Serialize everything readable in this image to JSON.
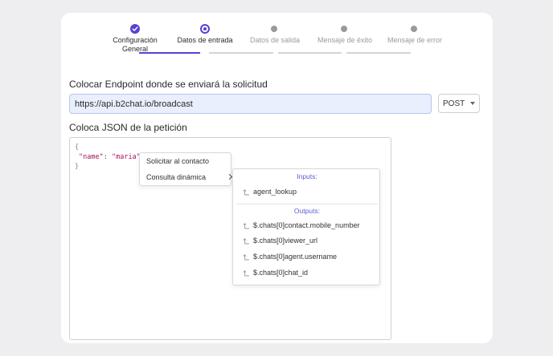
{
  "stepper": {
    "steps": [
      {
        "label_line1": "Configuración",
        "label_line2": "General",
        "state": "done"
      },
      {
        "label_line1": "Datos de entrada",
        "label_line2": "",
        "state": "current"
      },
      {
        "label_line1": "Datos de salida",
        "label_line2": "",
        "state": "todo"
      },
      {
        "label_line1": "Mensaje de éxito",
        "label_line2": "",
        "state": "todo"
      },
      {
        "label_line1": "Mensaje de error",
        "label_line2": "",
        "state": "todo"
      }
    ],
    "accent_color": "#5b3fd6",
    "todo_color": "#9a9a9a"
  },
  "endpoint": {
    "title": "Colocar Endpoint donde se enviará la solicitud",
    "url_value": "https://api.b2chat.io/broadcast",
    "method": "POST"
  },
  "json_section": {
    "title": "Coloca JSON de la petición",
    "code": {
      "open_brace": "{",
      "key": "\"name\"",
      "colon": ": ",
      "value": "\"maria\"",
      "close_brace": "}"
    }
  },
  "context_menu": {
    "items": [
      "Solicitar al contacto",
      "Consulta dinámica"
    ]
  },
  "dynamic_menu": {
    "inputs_label": "Inputs:",
    "inputs": [
      "agent_lookup"
    ],
    "outputs_label": "Outputs:",
    "outputs": [
      "$.chats[0]contact.mobile_number",
      "$.chats[0]viewer_url",
      "$.chats[0]agent.username",
      "$.chats[0]chat_id"
    ],
    "item_icon": "arrow-up-corner-icon"
  }
}
